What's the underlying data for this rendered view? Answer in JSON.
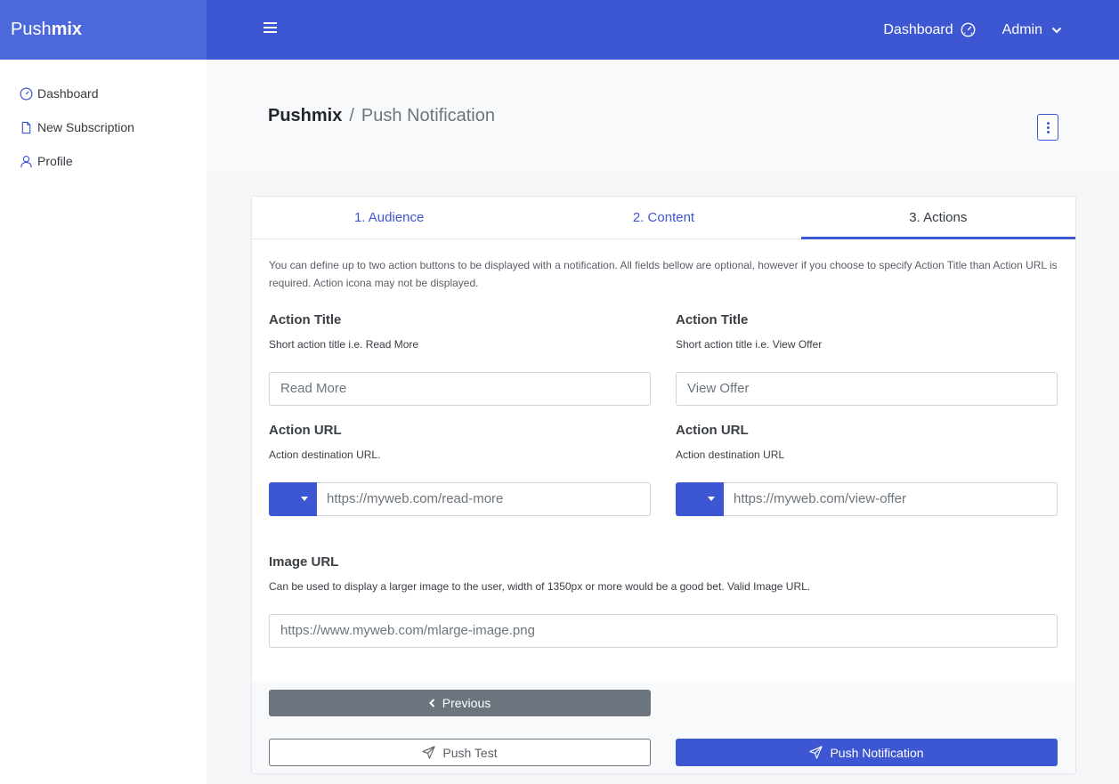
{
  "app": {
    "brand_part1": "Push",
    "brand_part2": "mix"
  },
  "topbar": {
    "dashboard_label": "Dashboard",
    "user_label": "Admin"
  },
  "sidebar": {
    "items": [
      {
        "label": "Dashboard",
        "icon": "dashboard-icon"
      },
      {
        "label": "New Subscription",
        "icon": "document-icon"
      },
      {
        "label": "Profile",
        "icon": "user-icon"
      }
    ]
  },
  "breadcrumb": {
    "home": "Pushmix",
    "separator": "/",
    "current": "Push Notification"
  },
  "tabs": [
    {
      "label": "1. Audience",
      "active": false
    },
    {
      "label": "2. Content",
      "active": false
    },
    {
      "label": "3. Actions",
      "active": true
    }
  ],
  "form": {
    "intro": "You can define up to two action buttons to be displayed with a notification. All fields bellow are optional, however if you choose to specify Action Title than Action URL is required. Action icona may not be displayed.",
    "action1": {
      "title_label": "Action Title",
      "title_help": "Short action title i.e. Read More",
      "title_placeholder": "Read More",
      "url_label": "Action URL",
      "url_help": "Action destination URL.",
      "url_placeholder": "https://myweb.com/read-more"
    },
    "action2": {
      "title_label": "Action Title",
      "title_help": "Short action title i.e. View Offer",
      "title_placeholder": "View Offer",
      "url_label": "Action URL",
      "url_help": "Action destination URL",
      "url_placeholder": "https://myweb.com/view-offer"
    },
    "image": {
      "label": "Image URL",
      "help": "Can be used to display a larger image to the user, width of 1350px or more would be a good bet. Valid Image URL.",
      "placeholder": "https://www.myweb.com/mlarge-image.png"
    }
  },
  "buttons": {
    "previous": "Previous",
    "push_test": "Push Test",
    "push_notification": "Push Notification"
  },
  "colors": {
    "primary": "#3d56d1",
    "brand_bg": "#4d68db",
    "secondary": "#6c757d"
  }
}
